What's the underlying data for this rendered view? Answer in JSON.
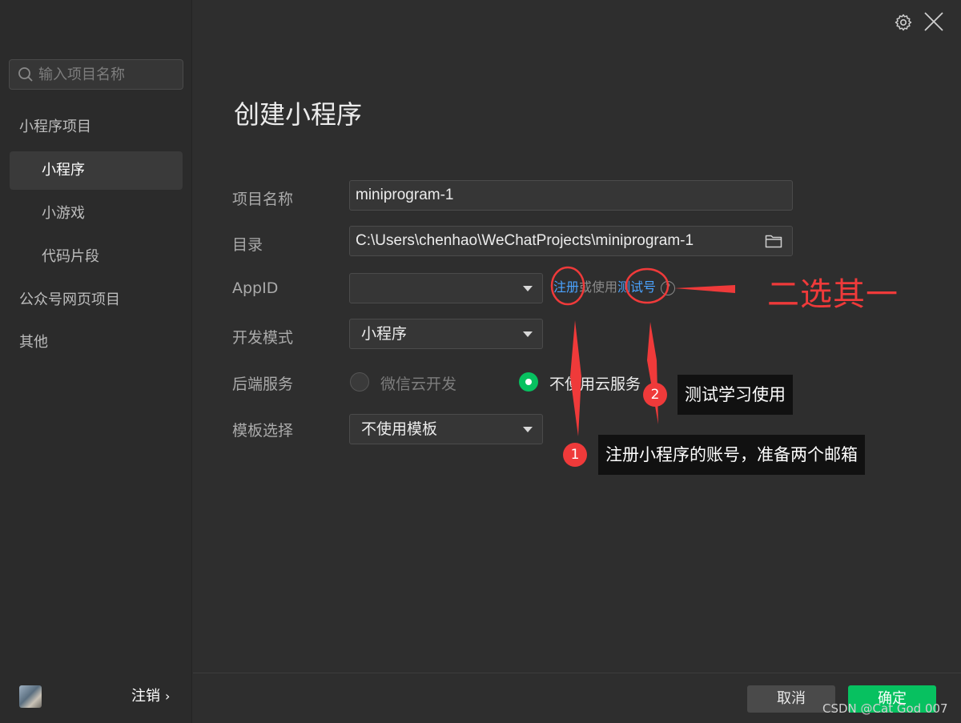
{
  "sidebar": {
    "search_placeholder": "输入项目名称",
    "items": [
      {
        "label": "小程序项目"
      },
      {
        "label": "小程序"
      },
      {
        "label": "小游戏"
      },
      {
        "label": "代码片段"
      },
      {
        "label": "公众号网页项目"
      },
      {
        "label": "其他"
      }
    ],
    "logout_label": "注销",
    "logout_chevron": "›"
  },
  "main": {
    "title": "创建小程序",
    "form": {
      "project_name_label": "项目名称",
      "project_name_value": "miniprogram-1",
      "directory_label": "目录",
      "directory_value": "C:\\Users\\chenhao\\WeChatProjects\\miniprogram-1",
      "appid_label": "AppID",
      "appid_value": "",
      "appid_register": "注册",
      "appid_or_use": "或使用",
      "appid_test": "测试号",
      "appid_help": "?",
      "dev_mode_label": "开发模式",
      "dev_mode_value": "小程序",
      "backend_label": "后端服务",
      "backend_options": [
        {
          "label": "微信云开发",
          "selected": false
        },
        {
          "label": "不使用云服务",
          "selected": true
        }
      ],
      "template_label": "模板选择",
      "template_value": "不使用模板"
    },
    "buttons": {
      "cancel": "取消",
      "ok": "确定"
    }
  },
  "annotations": {
    "choose_one": "二选其一",
    "badge1": "1",
    "note1": "注册小程序的账号，准备两个邮箱",
    "badge2": "2",
    "note2": "测试学习使用",
    "color": "#ef3a3a"
  },
  "watermark": "CSDN @Cat God 007",
  "colors": {
    "accent": "#07c160",
    "link": "#4aa3ff",
    "background": "#2e2e2e",
    "sidebar": "#2b2b2b"
  }
}
